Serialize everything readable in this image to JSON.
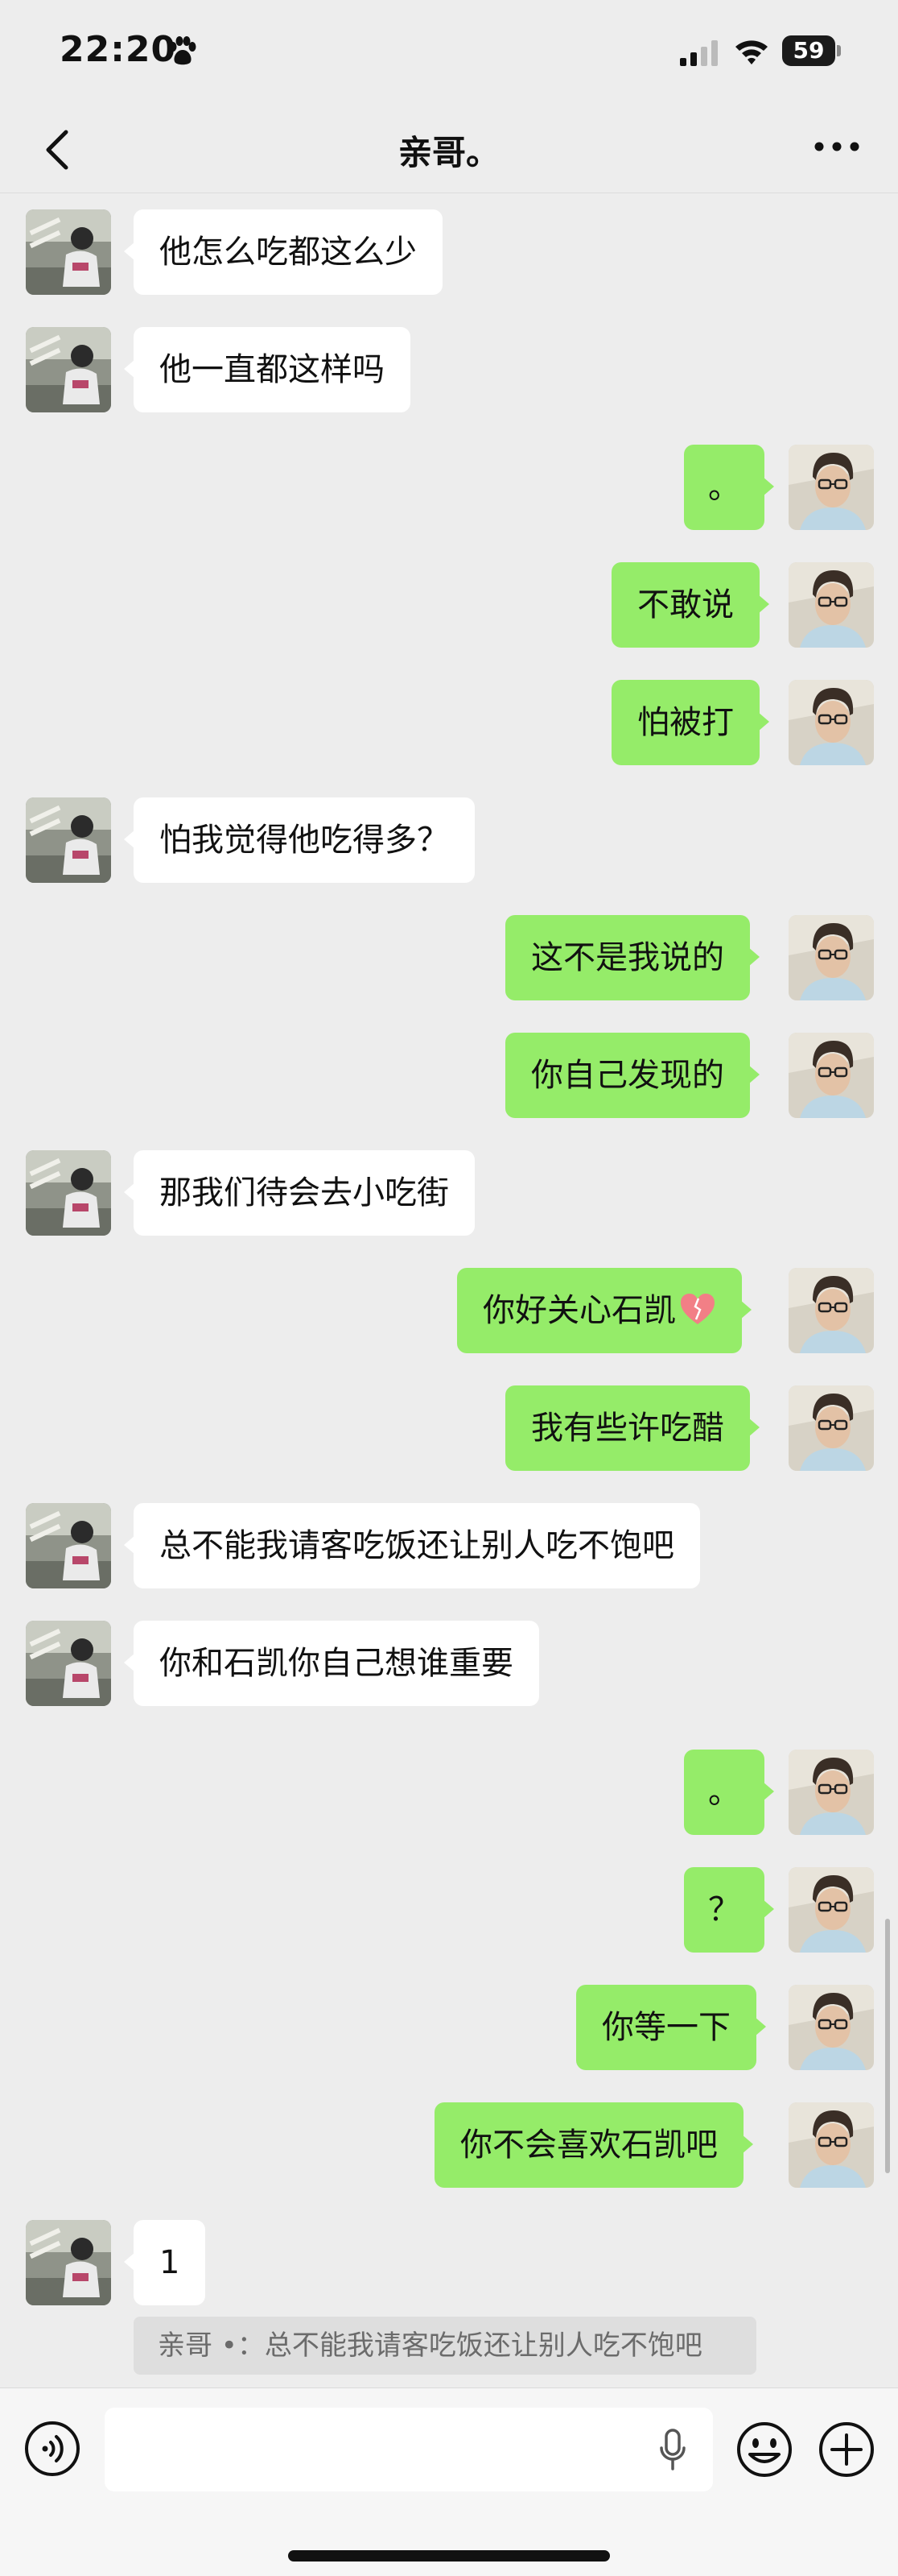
{
  "status_bar": {
    "time": "22:20",
    "battery": "59"
  },
  "header": {
    "title": "亲哥。"
  },
  "messages": [
    {
      "side": "left",
      "text": "他怎么吃都这么少"
    },
    {
      "side": "left",
      "text": "他一直都这样吗"
    },
    {
      "side": "right",
      "text": "。"
    },
    {
      "side": "right",
      "text": "不敢说"
    },
    {
      "side": "right",
      "text": "怕被打"
    },
    {
      "side": "left",
      "text": "怕我觉得他吃得多？"
    },
    {
      "side": "right",
      "text": "这不是我说的"
    },
    {
      "side": "right",
      "text": "你自己发现的"
    },
    {
      "side": "left",
      "text": "那我们待会去小吃街"
    },
    {
      "side": "right",
      "text": "你好关心石凯"
    },
    {
      "side": "right",
      "text": "我有些许吃醋"
    },
    {
      "side": "left",
      "text": "总不能我请客吃饭还让别人吃不饱吧"
    },
    {
      "side": "left",
      "text": "你和石凯你自己想谁重要"
    },
    {
      "side": "right",
      "text": "。"
    },
    {
      "side": "right",
      "text": "？"
    },
    {
      "side": "right",
      "text": "你等一下"
    },
    {
      "side": "right",
      "text": "你不会喜欢石凯吧"
    },
    {
      "side": "left",
      "text": "1"
    }
  ],
  "quote": {
    "text": "亲哥 •：总不能我请客吃饭还让别人吃不饱吧"
  },
  "colors": {
    "bubble_self": "#95ec69",
    "bubble_other": "#ffffff",
    "background": "#ededed"
  },
  "icons": [
    "paw-icon",
    "signal-icon",
    "wifi-icon",
    "battery-icon",
    "back-arrow-icon",
    "more-icon",
    "heart-icon",
    "voice-icon",
    "mic-icon",
    "emoji-icon",
    "plus-icon"
  ]
}
